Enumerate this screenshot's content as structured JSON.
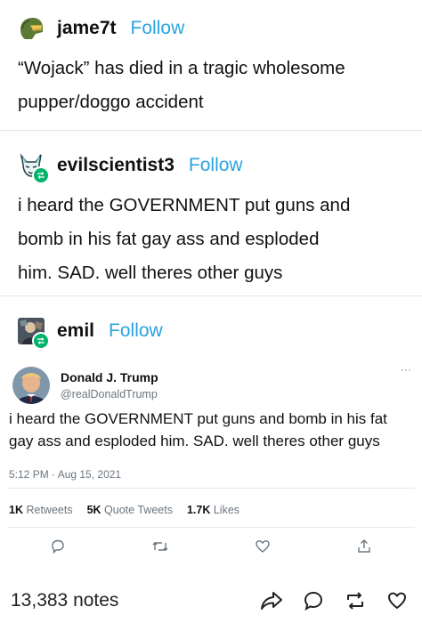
{
  "posts": [
    {
      "username": "jame7t",
      "follow_label": "Follow",
      "text_lines": [
        "“Wojack” has died in a tragic wholesome",
        "pupper/doggo accident"
      ]
    },
    {
      "username": "evilscientist3",
      "follow_label": "Follow",
      "text_lines": [
        "i heard the GOVERNMENT put guns and",
        "bomb in his fat gay ass and esploded",
        "him. SAD. well theres other guys"
      ]
    },
    {
      "username": "emil",
      "follow_label": "Follow"
    }
  ],
  "tweet": {
    "name": "Donald J. Trump",
    "handle": "@realDonaldTrump",
    "more": "···",
    "text_lines": [
      "i heard the GOVERNMENT put guns and bomb in his fat",
      "gay ass and esploded him. SAD. well theres other guys"
    ],
    "timestamp": "5:12 PM · Aug 15, 2021",
    "retweets_count": "1K",
    "retweets_label": "Retweets",
    "quotes_count": "5K",
    "quotes_label": "Quote Tweets",
    "likes_count": "1.7K",
    "likes_label": "Likes"
  },
  "footer": {
    "notes": "13,383 notes"
  },
  "colors": {
    "follow": "#2aa3e0",
    "reblog_badge": "#00b36b",
    "twitter_icon": "#6b7680"
  }
}
